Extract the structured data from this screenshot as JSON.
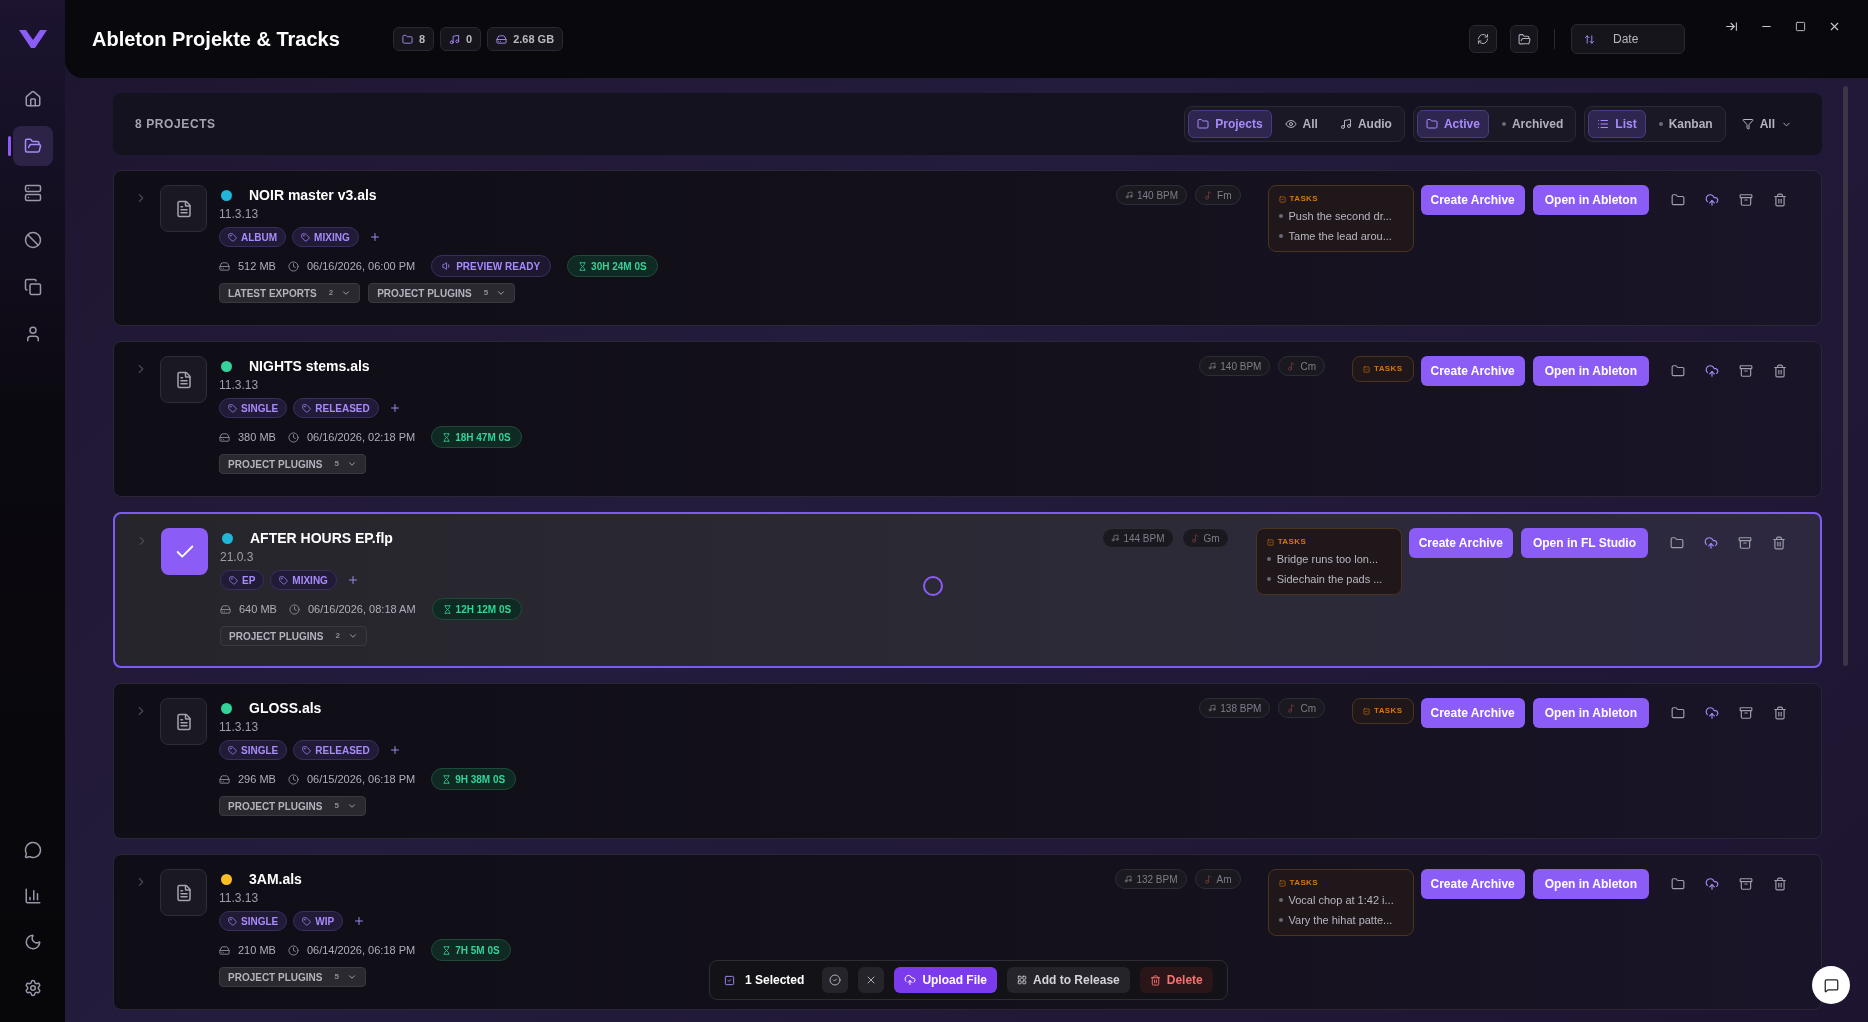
{
  "sidebar": {
    "items": [
      {
        "selected": false
      },
      {
        "selected": true
      },
      {
        "selected": false
      },
      {
        "selected": false
      },
      {
        "selected": false
      },
      {
        "selected": false
      }
    ],
    "bottom_items": [
      {
        "selected": false
      },
      {
        "selected": false
      },
      {
        "selected": false
      },
      {
        "selected": false
      }
    ]
  },
  "header": {
    "title": "Ableton Projekte & Tracks",
    "stats": [
      "8",
      "0",
      "2.68 GB"
    ],
    "sort": {
      "value": "Date"
    }
  },
  "toolbar": {
    "count": "8 PROJECTS",
    "groups": [
      [
        {
          "label": "Projects",
          "selected": true
        },
        {
          "label": "All",
          "selected": false
        },
        {
          "label": "Audio",
          "selected": false
        }
      ],
      [
        {
          "label": "Active",
          "selected": true
        },
        {
          "label": "Archived",
          "selected": false
        }
      ],
      [
        {
          "label": "List",
          "selected": true
        },
        {
          "label": "Kanban",
          "selected": false
        }
      ]
    ],
    "filter": "All"
  },
  "projects": [
    {
      "name": "NOIR master v3.als",
      "version": "11.3.13",
      "color": "#1fb6d9",
      "selected": false,
      "tags": [
        "ALBUM",
        "MIXING"
      ],
      "size": "512 MB",
      "date": "06/16/2026, 06:00 PM",
      "preview": "PREVIEW READY",
      "duration": "30H 24M 0S",
      "dropdowns": [
        {
          "label": "LATEST EXPORTS",
          "count": "2"
        },
        {
          "label": "PROJECT PLUGINS",
          "count": "5"
        }
      ],
      "bpm": "140 BPM",
      "key": "Fm",
      "tasks": {
        "label": "TASKS",
        "items": [
          "Push the second dr...",
          "Tame the lead arou..."
        ]
      },
      "archive_button": "Create Archive",
      "open_button": "Open in Ableton"
    },
    {
      "name": "NIGHTS stems.als",
      "version": "11.3.13",
      "color": "#34d399",
      "selected": false,
      "tags": [
        "SINGLE",
        "RELEASED"
      ],
      "size": "380 MB",
      "date": "06/16/2026, 02:18 PM",
      "duration": "18H 47M 0S",
      "dropdowns": [
        {
          "label": "PROJECT PLUGINS",
          "count": "5"
        }
      ],
      "bpm": "140 BPM",
      "key": "Cm",
      "tasks": {
        "label": "TASKS"
      },
      "archive_button": "Create Archive",
      "open_button": "Open in Ableton"
    },
    {
      "name": "AFTER HOURS EP.flp",
      "version": "21.0.3",
      "color": "#1fb6d9",
      "selected": true,
      "tags": [
        "EP",
        "MIXING"
      ],
      "size": "640 MB",
      "date": "06/16/2026, 08:18 AM",
      "duration": "12H 12M 0S",
      "dropdowns": [
        {
          "label": "PROJECT PLUGINS",
          "count": "2"
        }
      ],
      "bpm": "144 BPM",
      "key": "Gm",
      "tasks": {
        "label": "TASKS",
        "items": [
          "Bridge runs too lon...",
          "Sidechain the pads ..."
        ]
      },
      "archive_button": "Create Archive",
      "open_button": "Open in FL Studio"
    },
    {
      "name": "GLOSS.als",
      "version": "11.3.13",
      "color": "#34d399",
      "selected": false,
      "tags": [
        "SINGLE",
        "RELEASED"
      ],
      "size": "296 MB",
      "date": "06/15/2026, 06:18 PM",
      "duration": "9H 38M 0S",
      "dropdowns": [
        {
          "label": "PROJECT PLUGINS",
          "count": "5"
        }
      ],
      "bpm": "138 BPM",
      "key": "Cm",
      "tasks": {
        "label": "TASKS"
      },
      "archive_button": "Create Archive",
      "open_button": "Open in Ableton"
    },
    {
      "name": "3AM.als",
      "version": "11.3.13",
      "color": "#fbbf24",
      "selected": false,
      "tags": [
        "SINGLE",
        "WIP"
      ],
      "size": "210 MB",
      "date": "06/14/2026, 06:18 PM",
      "duration": "7H 5M 0S",
      "dropdowns": [
        {
          "label": "PROJECT PLUGINS",
          "count": "5"
        }
      ],
      "bpm": "132 BPM",
      "key": "Am",
      "tasks": {
        "label": "TASKS",
        "items": [
          "Vocal chop at 1:42 i...",
          "Vary the hihat patte..."
        ]
      },
      "archive_button": "Create Archive",
      "open_button": "Open in Ableton"
    }
  ],
  "selection_bar": {
    "count": "1 Selected",
    "upload": "Upload File",
    "add": "Add to Release",
    "delete": "Delete"
  }
}
